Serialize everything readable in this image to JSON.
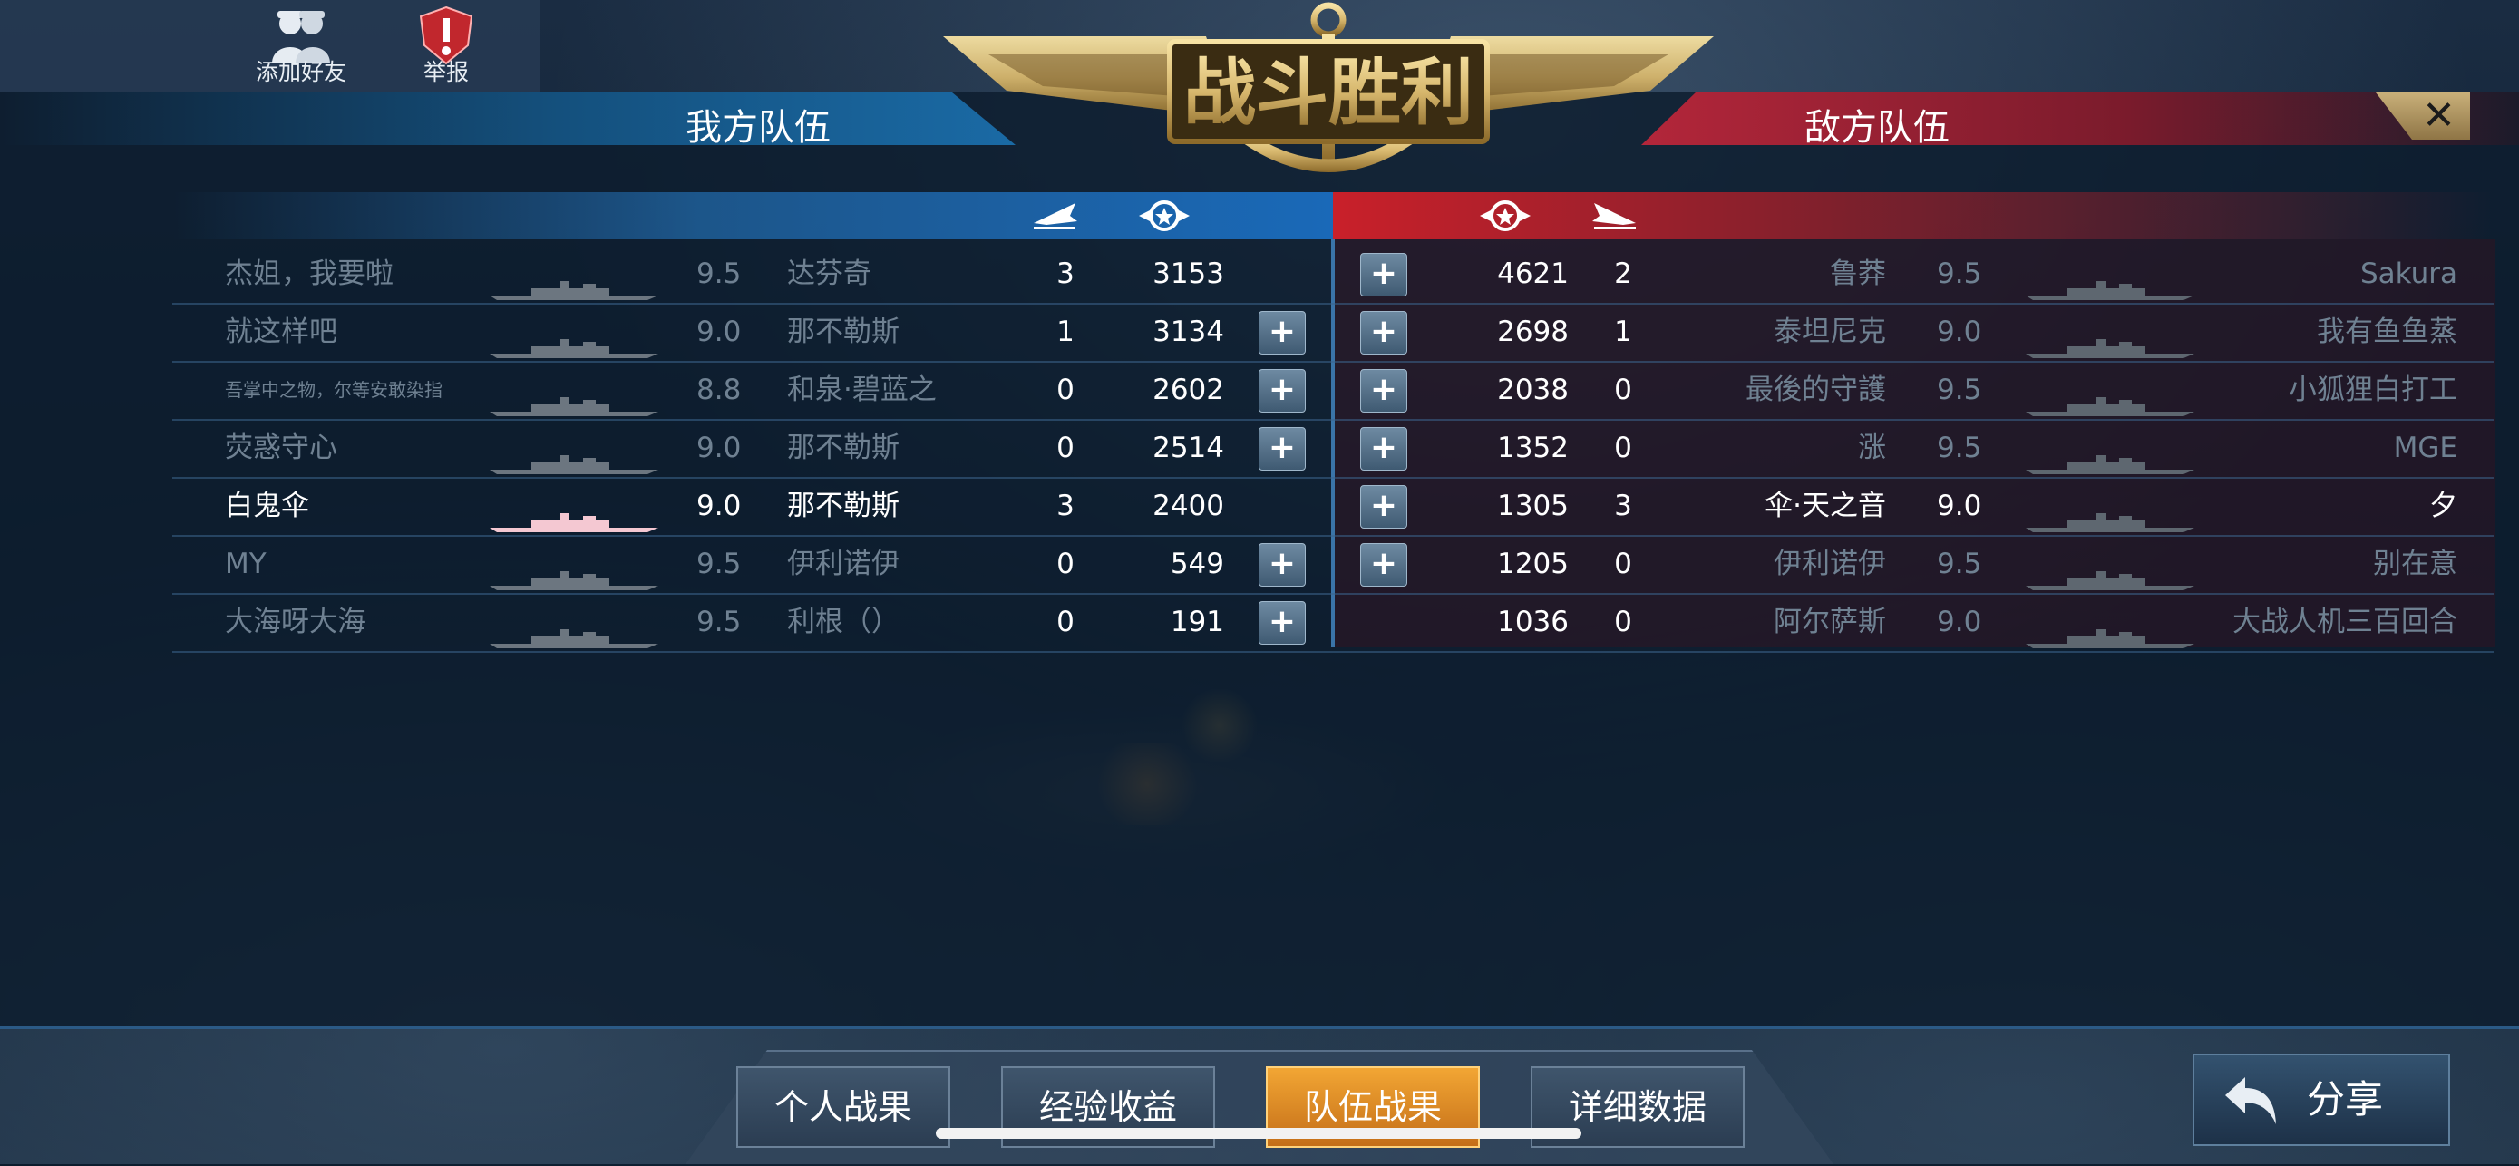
{
  "top_buttons": {
    "add_friend": "添加好友",
    "report": "举报"
  },
  "banner": {
    "title": "战斗胜利"
  },
  "teams": {
    "ours": "我方队伍",
    "enemy": "敌方队伍"
  },
  "close_label": "✕",
  "our_team": [
    {
      "name": "杰姐，我要啦",
      "level": "9.5",
      "ship": "达芬奇",
      "kills": "3",
      "score": "3153",
      "plus": false
    },
    {
      "name": "就这样吧",
      "level": "9.0",
      "ship": "那不勒斯",
      "kills": "1",
      "score": "3134",
      "plus": true
    },
    {
      "name": "吾掌中之物，尔等安敢染指",
      "level": "8.8",
      "ship": "和泉·碧蓝之",
      "kills": "0",
      "score": "2602",
      "plus": true
    },
    {
      "name": "荧惑守心",
      "level": "9.0",
      "ship": "那不勒斯",
      "kills": "0",
      "score": "2514",
      "plus": true
    },
    {
      "name": "白鬼伞",
      "level": "9.0",
      "ship": "那不勒斯",
      "kills": "3",
      "score": "2400",
      "plus": false,
      "is_me": true
    },
    {
      "name": "MY",
      "level": "9.5",
      "ship": "伊利诺伊",
      "kills": "0",
      "score": "549",
      "plus": true
    },
    {
      "name": "大海呀大海",
      "level": "9.5",
      "ship": "利根（）",
      "kills": "0",
      "score": "191",
      "plus": true
    }
  ],
  "enemy_team": [
    {
      "name": "Sakura",
      "level": "9.5",
      "ship": "鲁莽",
      "kills": "2",
      "score": "4621",
      "plus": true
    },
    {
      "name": "我有鱼鱼蒸",
      "level": "9.0",
      "ship": "泰坦尼克",
      "kills": "1",
      "score": "2698",
      "plus": true
    },
    {
      "name": "小狐狸白打工",
      "level": "9.5",
      "ship": "最後的守護",
      "kills": "0",
      "score": "2038",
      "plus": true
    },
    {
      "name": "MGE",
      "level": "9.5",
      "ship": "涨",
      "kills": "0",
      "score": "1352",
      "plus": true
    },
    {
      "name": "夕",
      "level": "9.0",
      "ship": "伞·天之音",
      "kills": "3",
      "score": "1305",
      "plus": true
    },
    {
      "name": "别在意",
      "level": "9.5",
      "ship": "伊利诺伊",
      "kills": "0",
      "score": "1205",
      "plus": true
    },
    {
      "name": "大战人机三百回合",
      "level": "9.0",
      "ship": "阿尔萨斯",
      "kills": "0",
      "score": "1036",
      "plus": false
    }
  ],
  "tabs": [
    "个人战果",
    "经验收益",
    "队伍战果",
    "详细数据"
  ],
  "active_tab": "队伍战果",
  "share_label": "分享",
  "colors": {
    "ally": "#1a6aa5",
    "enemy": "#b3263a",
    "active_tab": "#f2a634",
    "gold": "#d6b66c"
  }
}
